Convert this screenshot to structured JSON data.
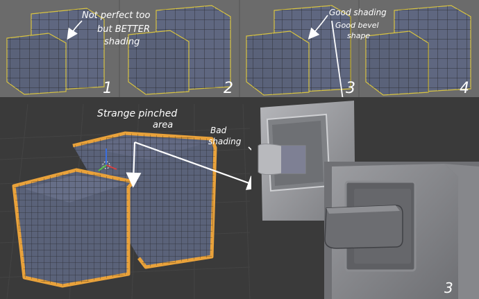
{
  "annotations": {
    "not_perfect_line1": "Not perfect too",
    "not_perfect_line2": "but BETTER",
    "not_perfect_line3": "shading",
    "strange_line1": "Strange pinched",
    "strange_line2": "area",
    "bad_line1": "Bad",
    "bad_line2": "shading",
    "good_shading": "Good shading",
    "good_bevel_line1": "Good bevel",
    "good_bevel_line2": "shape"
  },
  "panel_numbers": {
    "p1": "1",
    "p2": "2",
    "p3": "3",
    "p4": "4",
    "detail": "3"
  },
  "colors": {
    "viewport_bg": "#3a3a3a",
    "top_strip_bg": "#6b6b6b",
    "mesh_face": "#5a6279",
    "wire": "#1b1b1b",
    "selected_edge": "#e9a23b",
    "boundary_edge": "#d9c440",
    "render_bg": "#9a9a9a",
    "render_surface": "#8c8d90",
    "annotation": "#ffffff"
  }
}
